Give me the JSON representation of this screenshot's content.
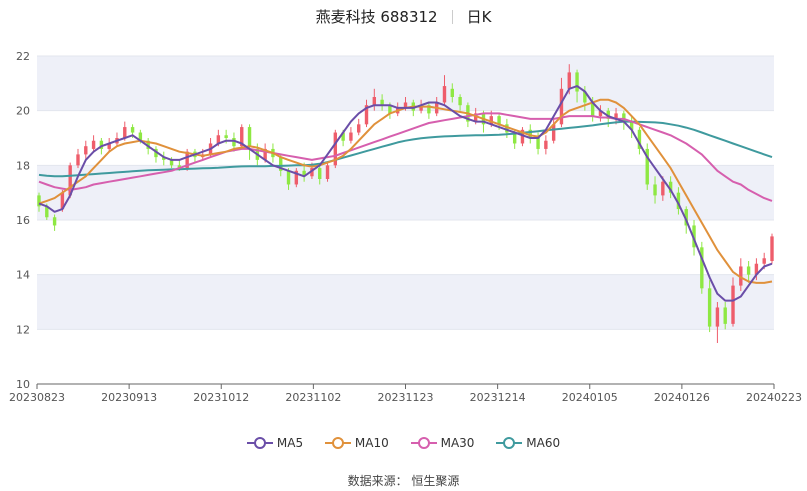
{
  "title": {
    "stock": "燕麦科技 688312",
    "period": "日K"
  },
  "source": "数据来源： 恒生聚源",
  "colors": {
    "up": "#ee5d6b",
    "down": "#8ee843",
    "ma5": "#6a4ea8",
    "ma10": "#e0913b",
    "ma30": "#d65fae",
    "ma60": "#3f9a9e",
    "band": "#eef0f8"
  },
  "chart_data": {
    "type": "candlestick",
    "x_ticks": [
      "20230823",
      "20230913",
      "20231012",
      "20231102",
      "20231123",
      "20231214",
      "20240105",
      "20240126",
      "20240223"
    ],
    "ylim": [
      10,
      22
    ],
    "y_ticks": [
      "10",
      "12",
      "14",
      "16",
      "18",
      "20",
      "22"
    ],
    "legend": [
      "MA5",
      "MA10",
      "MA30",
      "MA60"
    ],
    "candles": [
      [
        16.9,
        16.5,
        17.0,
        16.3
      ],
      [
        16.5,
        16.1,
        16.6,
        16.0
      ],
      [
        16.1,
        15.8,
        16.2,
        15.6
      ],
      [
        16.4,
        17.0,
        17.1,
        16.3
      ],
      [
        16.9,
        18.0,
        18.1,
        16.8
      ],
      [
        18.0,
        18.4,
        18.6,
        17.9
      ],
      [
        18.4,
        18.7,
        18.9,
        18.2
      ],
      [
        18.6,
        18.9,
        19.1,
        18.5
      ],
      [
        18.9,
        18.6,
        19.0,
        18.4
      ],
      [
        18.6,
        18.8,
        19.0,
        18.5
      ],
      [
        18.8,
        19.0,
        19.2,
        18.7
      ],
      [
        19.0,
        19.4,
        19.6,
        18.9
      ],
      [
        19.4,
        19.2,
        19.5,
        19.0
      ],
      [
        19.2,
        18.9,
        19.3,
        18.8
      ],
      [
        18.9,
        18.6,
        19.0,
        18.4
      ],
      [
        18.6,
        18.3,
        18.7,
        18.1
      ],
      [
        18.3,
        18.2,
        18.5,
        18.0
      ],
      [
        18.2,
        18.0,
        18.3,
        17.9
      ],
      [
        18.0,
        17.9,
        18.2,
        17.8
      ],
      [
        17.9,
        18.5,
        18.6,
        17.8
      ],
      [
        18.5,
        18.3,
        18.6,
        18.1
      ],
      [
        18.3,
        18.4,
        18.6,
        18.2
      ],
      [
        18.4,
        18.8,
        19.0,
        18.3
      ],
      [
        18.8,
        19.1,
        19.3,
        18.7
      ],
      [
        19.1,
        19.0,
        19.3,
        18.8
      ],
      [
        19.0,
        18.7,
        19.2,
        18.5
      ],
      [
        18.7,
        19.4,
        19.5,
        18.6
      ],
      [
        19.4,
        18.7,
        19.5,
        18.2
      ],
      [
        18.6,
        18.2,
        18.8,
        18.0
      ],
      [
        18.2,
        18.6,
        18.8,
        18.1
      ],
      [
        18.6,
        18.3,
        18.8,
        18.1
      ],
      [
        18.3,
        17.8,
        18.4,
        17.6
      ],
      [
        17.8,
        17.3,
        17.9,
        17.1
      ],
      [
        17.3,
        17.8,
        17.9,
        17.2
      ],
      [
        17.8,
        17.6,
        18.1,
        17.4
      ],
      [
        17.6,
        17.9,
        18.1,
        17.5
      ],
      [
        17.9,
        17.5,
        18.0,
        17.3
      ],
      [
        17.5,
        18.0,
        18.1,
        17.4
      ],
      [
        18.0,
        19.2,
        19.3,
        17.9
      ],
      [
        19.2,
        18.9,
        19.3,
        18.7
      ],
      [
        18.9,
        19.2,
        19.4,
        18.8
      ],
      [
        19.2,
        19.5,
        19.7,
        19.1
      ],
      [
        19.5,
        20.2,
        20.4,
        19.4
      ],
      [
        20.2,
        20.5,
        20.8,
        20.0
      ],
      [
        20.4,
        20.2,
        20.6,
        20.0
      ],
      [
        20.2,
        19.9,
        20.3,
        19.7
      ],
      [
        19.9,
        20.1,
        20.3,
        19.8
      ],
      [
        20.1,
        20.3,
        20.5,
        20.0
      ],
      [
        20.3,
        20.0,
        20.4,
        19.8
      ],
      [
        20.0,
        20.2,
        20.4,
        19.9
      ],
      [
        20.2,
        19.9,
        20.3,
        19.7
      ],
      [
        19.9,
        20.3,
        20.5,
        19.8
      ],
      [
        20.3,
        20.9,
        21.3,
        20.2
      ],
      [
        20.8,
        20.5,
        21.0,
        20.3
      ],
      [
        20.5,
        20.2,
        20.6,
        20.0
      ],
      [
        20.2,
        19.6,
        20.3,
        19.4
      ],
      [
        19.6,
        19.9,
        20.1,
        19.5
      ],
      [
        19.9,
        19.5,
        20.0,
        19.2
      ],
      [
        19.5,
        19.8,
        20.0,
        19.4
      ],
      [
        19.8,
        19.5,
        19.9,
        19.3
      ],
      [
        19.5,
        19.2,
        19.7,
        19.0
      ],
      [
        19.2,
        18.8,
        19.3,
        18.6
      ],
      [
        18.8,
        19.3,
        19.4,
        18.7
      ],
      [
        19.3,
        19.0,
        19.5,
        18.8
      ],
      [
        19.0,
        18.6,
        19.2,
        18.4
      ],
      [
        18.6,
        18.9,
        19.1,
        18.4
      ],
      [
        18.9,
        19.5,
        19.7,
        18.8
      ],
      [
        19.5,
        20.8,
        21.2,
        19.4
      ],
      [
        20.8,
        21.4,
        21.7,
        20.6
      ],
      [
        21.4,
        20.7,
        21.5,
        20.3
      ],
      [
        20.7,
        20.3,
        20.9,
        20.0
      ],
      [
        20.3,
        19.8,
        20.5,
        19.6
      ],
      [
        19.8,
        20.0,
        20.2,
        19.6
      ],
      [
        20.0,
        19.7,
        20.1,
        19.4
      ],
      [
        19.7,
        19.9,
        20.1,
        19.5
      ],
      [
        19.9,
        19.6,
        20.0,
        19.3
      ],
      [
        19.6,
        19.3,
        19.8,
        19.0
      ],
      [
        19.3,
        18.6,
        19.4,
        18.4
      ],
      [
        18.6,
        17.3,
        18.8,
        17.1
      ],
      [
        17.3,
        16.9,
        17.6,
        16.6
      ],
      [
        16.9,
        17.4,
        17.6,
        16.7
      ],
      [
        17.4,
        17.0,
        17.6,
        16.8
      ],
      [
        17.0,
        16.4,
        17.2,
        16.2
      ],
      [
        16.4,
        15.8,
        16.5,
        15.5
      ],
      [
        15.8,
        15.0,
        16.0,
        14.7
      ],
      [
        15.0,
        13.5,
        15.2,
        13.3
      ],
      [
        13.5,
        12.1,
        13.8,
        11.9
      ],
      [
        12.1,
        12.8,
        13.0,
        11.5
      ],
      [
        12.8,
        12.2,
        13.0,
        12.0
      ],
      [
        12.2,
        13.6,
        13.9,
        12.1
      ],
      [
        13.6,
        14.3,
        14.6,
        13.4
      ],
      [
        14.3,
        14.0,
        14.5,
        13.7
      ],
      [
        14.0,
        14.4,
        14.6,
        13.8
      ],
      [
        14.4,
        14.6,
        14.8,
        14.2
      ],
      [
        14.5,
        15.4,
        15.5,
        14.4
      ]
    ],
    "ma5": [
      16.6,
      16.5,
      16.3,
      16.4,
      16.9,
      17.6,
      18.2,
      18.5,
      18.7,
      18.8,
      18.9,
      19.0,
      19.1,
      18.9,
      18.7,
      18.5,
      18.3,
      18.2,
      18.2,
      18.3,
      18.4,
      18.5,
      18.6,
      18.8,
      18.9,
      18.9,
      18.8,
      18.6,
      18.4,
      18.2,
      18.0,
      17.9,
      17.8,
      17.7,
      17.6,
      17.8,
      18.0,
      18.4,
      18.8,
      19.2,
      19.6,
      19.9,
      20.1,
      20.2,
      20.2,
      20.2,
      20.1,
      20.1,
      20.1,
      20.2,
      20.3,
      20.3,
      20.2,
      20.0,
      19.8,
      19.7,
      19.6,
      19.6,
      19.5,
      19.4,
      19.3,
      19.2,
      19.1,
      19.0,
      19.0,
      19.3,
      19.8,
      20.3,
      20.8,
      20.9,
      20.7,
      20.3,
      20.0,
      19.8,
      19.7,
      19.6,
      19.3,
      18.8,
      18.3,
      17.9,
      17.5,
      17.1,
      16.6,
      16.0,
      15.3,
      14.6,
      13.9,
      13.3,
      13.05,
      13.05,
      13.2,
      13.6,
      14.0,
      14.3,
      14.4
    ],
    "ma10": [
      16.6,
      16.7,
      16.8,
      17.0,
      17.2,
      17.4,
      17.6,
      17.9,
      18.2,
      18.5,
      18.7,
      18.8,
      18.85,
      18.9,
      18.85,
      18.8,
      18.7,
      18.6,
      18.5,
      18.45,
      18.4,
      18.35,
      18.4,
      18.45,
      18.5,
      18.6,
      18.65,
      18.7,
      18.65,
      18.55,
      18.45,
      18.3,
      18.2,
      18.1,
      18.0,
      17.95,
      18.0,
      18.1,
      18.2,
      18.35,
      18.6,
      18.9,
      19.2,
      19.5,
      19.7,
      19.9,
      20.0,
      20.1,
      20.15,
      20.15,
      20.15,
      20.1,
      20.05,
      20.0,
      19.95,
      19.9,
      19.8,
      19.7,
      19.6,
      19.5,
      19.4,
      19.3,
      19.2,
      19.1,
      19.05,
      19.2,
      19.5,
      19.8,
      20.0,
      20.1,
      20.2,
      20.3,
      20.4,
      20.4,
      20.3,
      20.1,
      19.8,
      19.5,
      19.1,
      18.7,
      18.3,
      17.9,
      17.4,
      16.9,
      16.4,
      15.9,
      15.4,
      14.9,
      14.5,
      14.1,
      13.9,
      13.75,
      13.7,
      13.7,
      13.75
    ],
    "ma30": [
      17.4,
      17.3,
      17.2,
      17.15,
      17.1,
      17.15,
      17.2,
      17.3,
      17.35,
      17.4,
      17.45,
      17.5,
      17.55,
      17.6,
      17.65,
      17.7,
      17.75,
      17.8,
      17.9,
      18.0,
      18.1,
      18.2,
      18.3,
      18.4,
      18.5,
      18.55,
      18.6,
      18.6,
      18.55,
      18.5,
      18.45,
      18.4,
      18.35,
      18.3,
      18.25,
      18.2,
      18.25,
      18.3,
      18.35,
      18.45,
      18.55,
      18.65,
      18.75,
      18.85,
      18.95,
      19.05,
      19.15,
      19.25,
      19.35,
      19.45,
      19.55,
      19.6,
      19.65,
      19.7,
      19.75,
      19.8,
      19.85,
      19.9,
      19.9,
      19.9,
      19.85,
      19.8,
      19.75,
      19.7,
      19.7,
      19.7,
      19.7,
      19.75,
      19.8,
      19.8,
      19.8,
      19.8,
      19.75,
      19.75,
      19.7,
      19.7,
      19.6,
      19.5,
      19.4,
      19.3,
      19.2,
      19.1,
      18.95,
      18.8,
      18.6,
      18.4,
      18.1,
      17.8,
      17.6,
      17.4,
      17.3,
      17.1,
      16.95,
      16.8,
      16.7
    ],
    "ma60": [
      17.65,
      17.62,
      17.6,
      17.6,
      17.62,
      17.64,
      17.66,
      17.68,
      17.7,
      17.72,
      17.74,
      17.76,
      17.78,
      17.8,
      17.82,
      17.83,
      17.84,
      17.85,
      17.86,
      17.87,
      17.88,
      17.89,
      17.9,
      17.91,
      17.93,
      17.95,
      17.96,
      17.97,
      17.97,
      17.97,
      17.98,
      17.98,
      17.99,
      18.0,
      18.0,
      18.02,
      18.06,
      18.12,
      18.2,
      18.28,
      18.36,
      18.44,
      18.52,
      18.6,
      18.68,
      18.76,
      18.84,
      18.9,
      18.95,
      18.99,
      19.02,
      19.04,
      19.06,
      19.07,
      19.08,
      19.09,
      19.1,
      19.1,
      19.11,
      19.12,
      19.14,
      19.16,
      19.19,
      19.22,
      19.25,
      19.28,
      19.31,
      19.34,
      19.37,
      19.4,
      19.43,
      19.46,
      19.5,
      19.54,
      19.57,
      19.6,
      19.6,
      19.59,
      19.58,
      19.57,
      19.55,
      19.5,
      19.45,
      19.38,
      19.3,
      19.2,
      19.1,
      19.0,
      18.9,
      18.8,
      18.7,
      18.6,
      18.5,
      18.4,
      18.3
    ]
  }
}
